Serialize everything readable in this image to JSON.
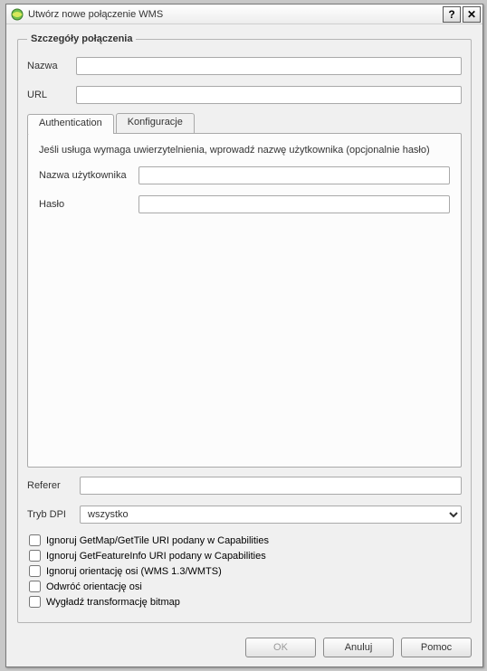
{
  "window": {
    "title": "Utwórz nowe połączenie WMS",
    "help_button": "?",
    "close_button": "✕"
  },
  "group": {
    "legend": "Szczegóły połączenia"
  },
  "fields": {
    "name_label": "Nazwa",
    "name_value": "",
    "url_label": "URL",
    "url_value": ""
  },
  "tabs": {
    "auth": "Authentication",
    "config": "Konfiguracje"
  },
  "auth": {
    "hint": "Jeśli usługa wymaga uwierzytelnienia, wprowadź nazwę użytkownika (opcjonalnie hasło)",
    "user_label": "Nazwa użytkownika",
    "user_value": "",
    "pass_label": "Hasło",
    "pass_value": ""
  },
  "referer": {
    "label": "Referer",
    "value": ""
  },
  "dpi": {
    "label": "Tryb DPI",
    "value": "wszystko"
  },
  "checks": {
    "ignore_getmap": "Ignoruj GetMap/GetTile URI podany w Capabilities",
    "ignore_getfeatureinfo": "Ignoruj GetFeatureInfo URI podany w Capabilities",
    "ignore_axis": "Ignoruj orientację osi (WMS 1.3/WMTS)",
    "invert_axis": "Odwróć orientację osi",
    "smooth_bitmap": "Wygładź transformację bitmap"
  },
  "buttons": {
    "ok": "OK",
    "cancel": "Anuluj",
    "help": "Pomoc"
  }
}
